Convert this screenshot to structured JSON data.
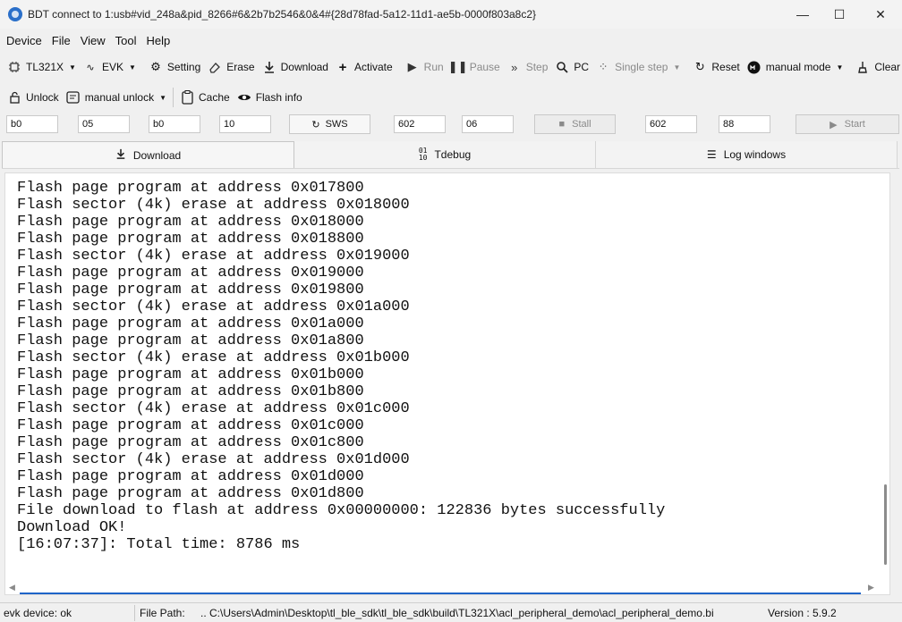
{
  "window": {
    "title": "BDT connect to 1:usb#vid_248a&pid_8266#6&2b7b2546&0&4#{28d78fad-5a12-11d1-ae5b-0000f803a8c2}",
    "minimize_glyph": "—",
    "maximize_glyph": "☐",
    "close_glyph": "✕"
  },
  "menu": [
    "Device",
    "File",
    "View",
    "Tool",
    "Help"
  ],
  "toolbar1": {
    "chip": "TL321X",
    "board": "EVK",
    "setting": "Setting",
    "erase": "Erase",
    "download": "Download",
    "activate": "Activate",
    "run": "Run",
    "pause": "Pause",
    "step": "Step",
    "pc": "PC",
    "single_step": "Single step",
    "reset": "Reset",
    "mode": "manual mode",
    "clear": "Clear"
  },
  "toolbar2": {
    "unlock": "Unlock",
    "manual_unlock": "manual unlock",
    "cache": "Cache",
    "flash_info": "Flash info"
  },
  "params": {
    "f1": "b0",
    "f2": "05",
    "f3": "b0",
    "f4": "10",
    "sws": "SWS",
    "f5": "602",
    "f6": "06",
    "stall": "Stall",
    "f7": "602",
    "f8": "88",
    "start": "Start"
  },
  "tabs": [
    "Download",
    "Tdebug",
    "Log windows"
  ],
  "log": [
    "Flash page program at address 0x017800",
    "Flash sector (4k) erase at address 0x018000",
    "Flash page program at address 0x018000",
    "Flash page program at address 0x018800",
    "Flash sector (4k) erase at address 0x019000",
    "Flash page program at address 0x019000",
    "Flash page program at address 0x019800",
    "Flash sector (4k) erase at address 0x01a000",
    "Flash page program at address 0x01a000",
    "Flash page program at address 0x01a800",
    "Flash sector (4k) erase at address 0x01b000",
    "Flash page program at address 0x01b000",
    "Flash page program at address 0x01b800",
    "Flash sector (4k) erase at address 0x01c000",
    "Flash page program at address 0x01c000",
    "Flash page program at address 0x01c800",
    "Flash sector (4k) erase at address 0x01d000",
    "Flash page program at address 0x01d000",
    "Flash page program at address 0x01d800",
    "File download to flash at address 0x00000000: 122836 bytes successfully",
    "Download OK!",
    "[16:07:37]: Total time: 8786 ms"
  ],
  "status": {
    "device": "evk device: ok",
    "file_path_label": "File Path:",
    "file_path": "..  C:\\Users\\Admin\\Desktop\\tl_ble_sdk\\tl_ble_sdk\\build\\TL321X\\acl_peripheral_demo\\acl_peripheral_demo.bi",
    "version": "Version : 5.9.2"
  },
  "colors": {
    "accent": "#1e64c8",
    "disabled": "#8a8a8a"
  }
}
